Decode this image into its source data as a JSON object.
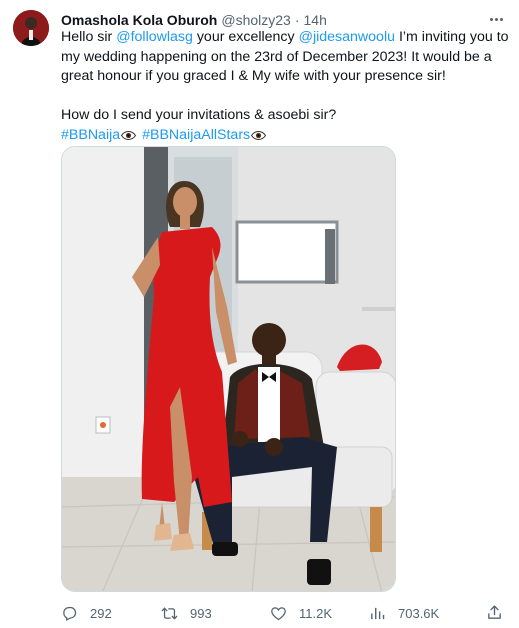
{
  "tweet": {
    "author_name": "Omashola Kola Oburoh",
    "author_handle": "@sholzy23",
    "separator": "·",
    "time": "14h",
    "body": {
      "line1_pre": "Hello sir ",
      "mention1": "@followlasg",
      "line1_mid": " your excellency ",
      "mention2": "@jidesanwoolu",
      "line1_post": " I’m inviting you to my wedding happening on the 23rd of December 2023! It would be a great honour if you graced I & My wife with your presence sir!",
      "line2": "How do I send your invitations & asoebi sir?",
      "hashtag1": "#BBNaija",
      "hashtag2": "#BBNaijaAllStars"
    }
  },
  "actions": {
    "replies": "292",
    "reposts": "993",
    "likes": "11.2K",
    "views": "703.6K"
  },
  "icons": {
    "more": "more-icon",
    "reply": "reply-icon",
    "repost": "repost-icon",
    "like": "heart-icon",
    "views": "views-icon",
    "share": "share-icon",
    "emoji": "eye-emoji-icon"
  },
  "colors": {
    "link": "#1d9bf0",
    "text": "#0f1419",
    "secondary": "#536471",
    "dress": "#d7191c"
  }
}
